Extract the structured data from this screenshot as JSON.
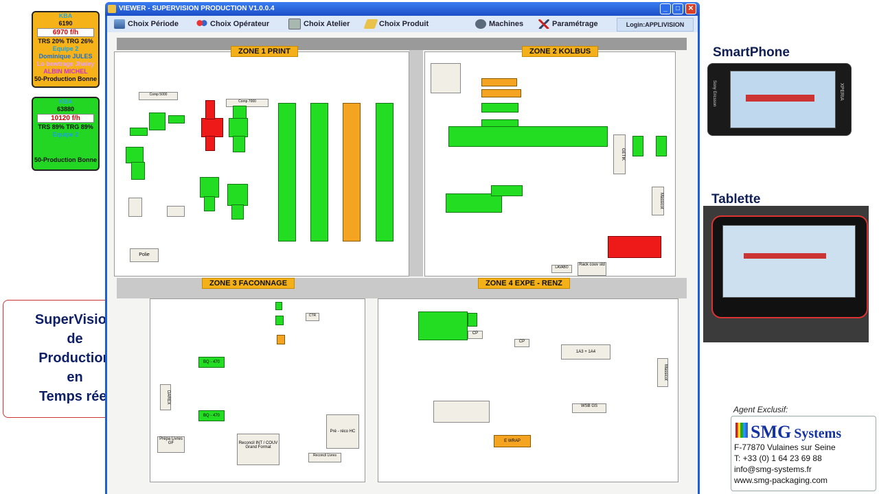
{
  "window": {
    "title": "VIEWER - SUPERVISION PRODUCTION V1.0.0.4",
    "controls": {
      "minimize": "_",
      "maximize": "□",
      "close": "✕"
    }
  },
  "menu": {
    "items": [
      {
        "label": "Choix Période",
        "icon": "hourglass-icon"
      },
      {
        "label": "Choix Opérateur",
        "icon": "operators-icon"
      },
      {
        "label": "Choix Atelier",
        "icon": "workshop-icon"
      },
      {
        "label": "Choix Produit",
        "icon": "product-icon"
      },
      {
        "label": "Machines",
        "icon": "machines-icon"
      },
      {
        "label": "Paramétrage",
        "icon": "tools-icon"
      }
    ],
    "login": "Login:APPLIVISION"
  },
  "cards": [
    {
      "brand": "KBA",
      "value": "6190",
      "rate": "6970 f/h",
      "kpi": "TRS 20% TRG 26%",
      "team": "Equipe 2",
      "operator1": "Dominique JULES",
      "operator2": "Lo bewtrage Jhaley",
      "operator3": "ALBIN MICHEL",
      "footer": "50-Production Bonne",
      "bg": "#f5b319"
    },
    {
      "brand": "KBA",
      "value": "63880",
      "rate": "10120 f/h",
      "kpi": "TRS 89% TRG 89%",
      "team": "Equipe 2",
      "operator1": "",
      "operator2": "",
      "operator3": "",
      "footer": "50-Production Bonne",
      "bg": "#24d624"
    }
  ],
  "zones": {
    "z1": "ZONE 1 PRINT",
    "z2": "ZONE 2 KOLBUS",
    "z3": "ZONE 3 FACONNAGE",
    "z4": "ZONE 4 EXPE - RENZ"
  },
  "plan_labels": {
    "comp5000": "Comp 5000",
    "comp7000": "Comp 7000",
    "polie": "Polie",
    "getik": "GETIK",
    "rack": "Rack couv std",
    "lavabo": "LAVABO",
    "massicot": "Massicot",
    "bq470a": "BQ - 470",
    "bq470b": "BQ - 470",
    "darex": "DAREX",
    "prepa": "Prépa Livres GF",
    "reconcil": "Reconcil INT / COUV Grand Format",
    "reconcil_livres": "Reconcil Livres",
    "preco": "Pré - réco HC",
    "ewrap": "E WRAP",
    "cp1": "CP",
    "cp2": "CP",
    "wsb": "WSB GS",
    "a1a": "1A3 + 1A4",
    "ctr": "CTR"
  },
  "brand_colors": {
    "green": "#22dd22",
    "orange": "#f4a420",
    "red": "#ee1a1a"
  },
  "side": {
    "smartphone": "SmartPhone",
    "tablet": "Tablette",
    "headline": [
      "SuperVision",
      "de",
      "Production",
      "en",
      "Temps réel"
    ],
    "agent": "Agent Exclusif:",
    "company": "SMG",
    "company_suffix": "Systems",
    "address": "F-77870 Vulaines sur Seine",
    "phone": "T: +33 (0) 1 64 23 69 88",
    "email": "info@smg-systems.fr",
    "web": "www.smg-packaging.com",
    "phone_brand": "XPERIA",
    "phone_maker": "Sony Ericsson"
  }
}
